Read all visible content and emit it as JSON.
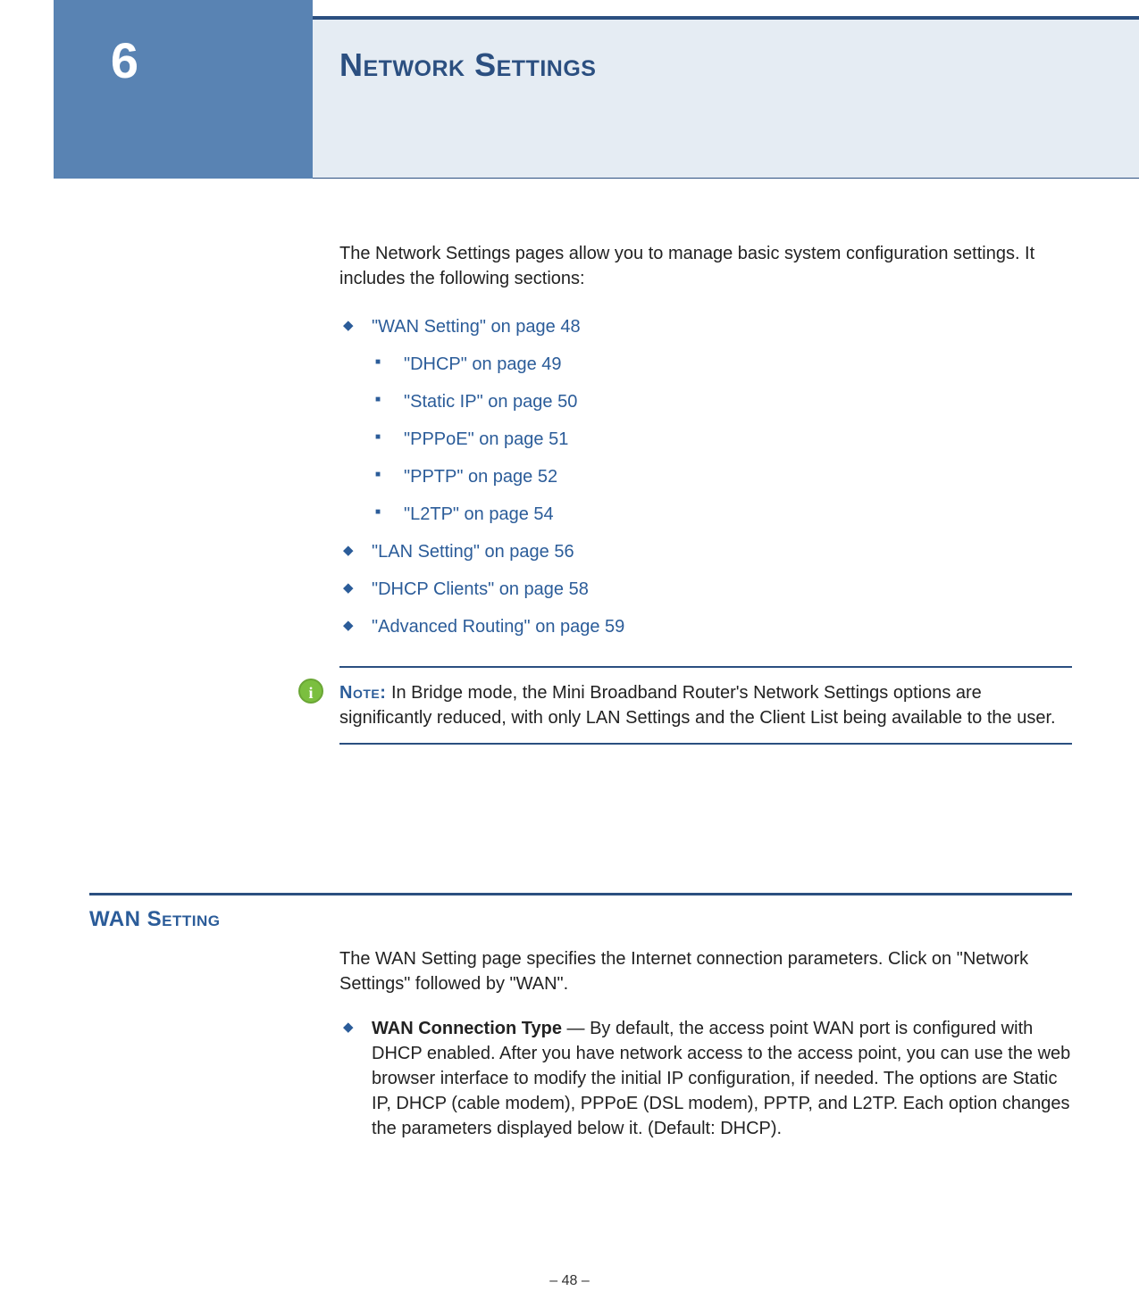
{
  "header": {
    "chapter_number": "6",
    "title": "Network Settings"
  },
  "intro": "The Network Settings pages allow you to manage basic system configuration settings. It includes the following sections:",
  "toc": {
    "items": [
      {
        "label": "\"WAN Setting\" on page 48"
      },
      {
        "label": "\"LAN Setting\" on page 56"
      },
      {
        "label": "\"DHCP Clients\" on page 58"
      },
      {
        "label": "\"Advanced Routing\" on page 59"
      }
    ],
    "wan_children": [
      {
        "label": "\"DHCP\" on page 49"
      },
      {
        "label": "\"Static IP\" on page 50"
      },
      {
        "label": "\"PPPoE\" on page 51"
      },
      {
        "label": "\"PPTP\" on page 52"
      },
      {
        "label": "\"L2TP\" on page 54"
      }
    ]
  },
  "note": {
    "icon": "i",
    "label": "Note:",
    "text": " In Bridge mode, the Mini Broadband Router's Network Settings options are significantly reduced, with only LAN Settings and the Client List being available to the user."
  },
  "section": {
    "heading": "WAN Setting",
    "intro": "The WAN Setting page specifies the Internet connection parameters. Click on \"Network Settings\" followed by \"WAN\".",
    "bullet_bold": "WAN Connection Type",
    "bullet_rest": " — By default, the access point WAN port is configured with DHCP enabled. After you have network access to the access point, you can use the web browser interface to modify the initial IP configuration, if needed. The options are Static IP, DHCP (cable modem), PPPoE (DSL modem), PPTP, and L2TP. Each option changes the parameters displayed below it. (Default: DHCP)."
  },
  "footer": {
    "page_number": "–  48  –"
  }
}
